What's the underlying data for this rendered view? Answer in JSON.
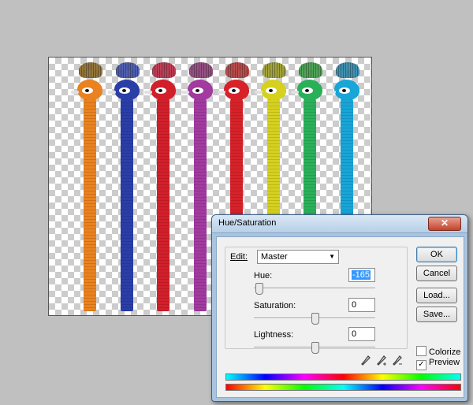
{
  "canvas": {
    "birds": [
      {
        "color": "#e9821f",
        "crest": "#8a6a2a"
      },
      {
        "color": "#2a3ea8",
        "crest": "#3f4fa8"
      },
      {
        "color": "#d2202b",
        "crest": "#b82c46"
      },
      {
        "color": "#a23aa0",
        "crest": "#8c3f78"
      },
      {
        "color": "#d7222a",
        "crest": "#b43a3a"
      },
      {
        "color": "#d6d11f",
        "crest": "#9a9b2a"
      },
      {
        "color": "#2bb05a",
        "crest": "#3e9b48"
      },
      {
        "color": "#18a5d8",
        "crest": "#2f86a8"
      }
    ]
  },
  "dialog": {
    "title": "Hue/Saturation",
    "close_label": "✕",
    "edit_label": "Edit:",
    "edit_value": "Master",
    "hue_label": "Hue:",
    "hue_value": "-165",
    "saturation_label": "Saturation:",
    "saturation_value": "0",
    "lightness_label": "Lightness:",
    "lightness_value": "0",
    "ok_label": "OK",
    "cancel_label": "Cancel",
    "load_label": "Load...",
    "save_label": "Save...",
    "colorize_label": "Colorize",
    "preview_label": "Preview",
    "colorize_checked": false,
    "preview_checked": true,
    "hue_slider_fraction": 0.04,
    "saturation_slider_fraction": 0.5,
    "lightness_slider_fraction": 0.5,
    "eyedroppers": [
      "eyedropper-icon",
      "eyedropper-plus-icon",
      "eyedropper-minus-icon"
    ]
  }
}
